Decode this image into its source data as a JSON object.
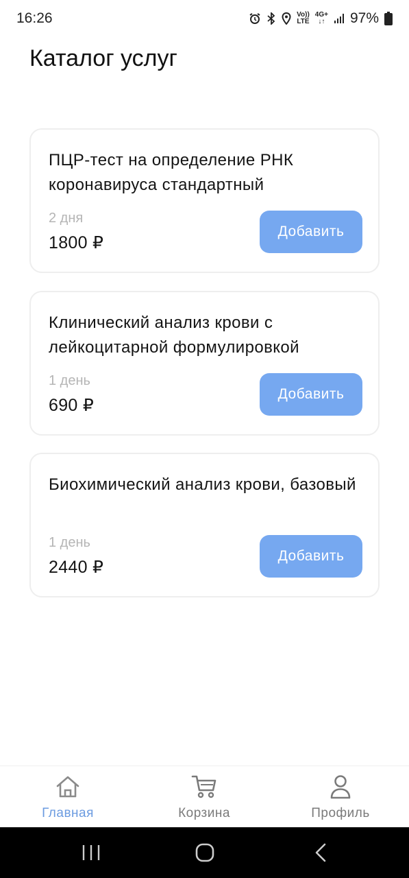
{
  "status_bar": {
    "time": "16:26",
    "volte_top": "Vo))",
    "volte_bottom": "LTE",
    "network": "4G+",
    "battery": "97%"
  },
  "page": {
    "title": "Каталог услуг"
  },
  "services": [
    {
      "title": "ПЦР-тест на определение РНК коронавируса стандартный",
      "duration": "2 дня",
      "price": "1800 ₽",
      "button_label": "Добавить"
    },
    {
      "title": "Клинический анализ крови с лейкоцитарной формулировкой",
      "duration": "1 день",
      "price": "690 ₽",
      "button_label": "Добавить"
    },
    {
      "title": "Биохимический анализ крови, базовый",
      "duration": "1 день",
      "price": "2440 ₽",
      "button_label": "Добавить"
    }
  ],
  "bottom_nav": {
    "items": [
      {
        "label": "Главная",
        "icon": "home-icon",
        "active": true
      },
      {
        "label": "Корзина",
        "icon": "cart-icon",
        "active": false
      },
      {
        "label": "Профиль",
        "icon": "profile-icon",
        "active": false
      }
    ]
  },
  "colors": {
    "accent": "#76a8f0",
    "active_nav": "#6b9be0",
    "muted_text": "#b5b5b5"
  }
}
